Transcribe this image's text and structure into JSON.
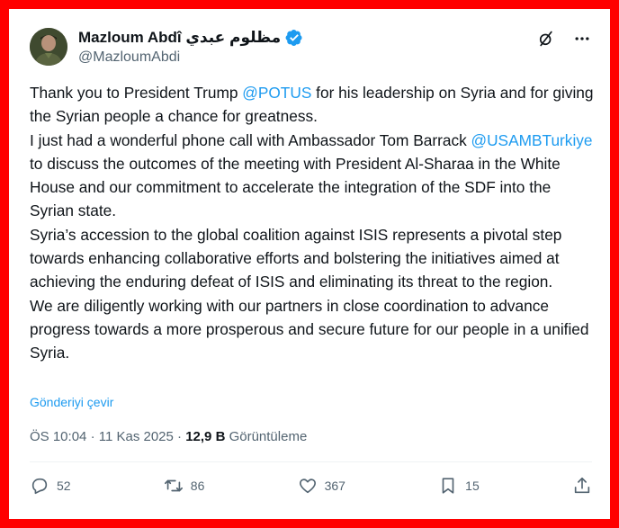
{
  "author": {
    "name": "Mazloum Abdî مظلوم عبدي",
    "handle": "@MazloumAbdi"
  },
  "tweet": {
    "paragraphs": [
      [
        "Thank you to President Trump ",
        "@POTUS",
        " for his leadership on Syria and for giving the Syrian people a chance for greatness."
      ],
      [
        "I just had a wonderful phone call with Ambassador Tom Barrack ",
        "@USAMBTurkiye",
        " to discuss the outcomes of the meeting with President Al-Sharaa in the White House and our commitment to accelerate the integration of the SDF into the Syrian state."
      ],
      [
        "Syria’s accession to the global coalition against ISIS represents a pivotal step towards enhancing collaborative efforts and bolstering the initiatives aimed at achieving the enduring defeat of ISIS and eliminating its threat to the region."
      ],
      [
        "We are diligently working with our partners in close coordination to advance progress towards a more prosperous and secure future for our people in a unified Syria."
      ]
    ],
    "translate_label": "Gönderiyi çevir"
  },
  "meta": {
    "time": "ÖS 10:04",
    "dot": "·",
    "date": "11 Kas 2025",
    "views_count": "12,9 B",
    "views_label": "Görüntüleme"
  },
  "actions": {
    "replies": "52",
    "reposts": "86",
    "likes": "367",
    "bookmarks": "15"
  },
  "colors": {
    "accent": "#1d9bf0",
    "frame": "#ff0000",
    "muted": "#536471"
  },
  "icons": [
    "verified-badge-icon",
    "grok-icon",
    "more-icon",
    "reply-icon",
    "repost-icon",
    "like-icon",
    "bookmark-icon",
    "share-icon"
  ]
}
